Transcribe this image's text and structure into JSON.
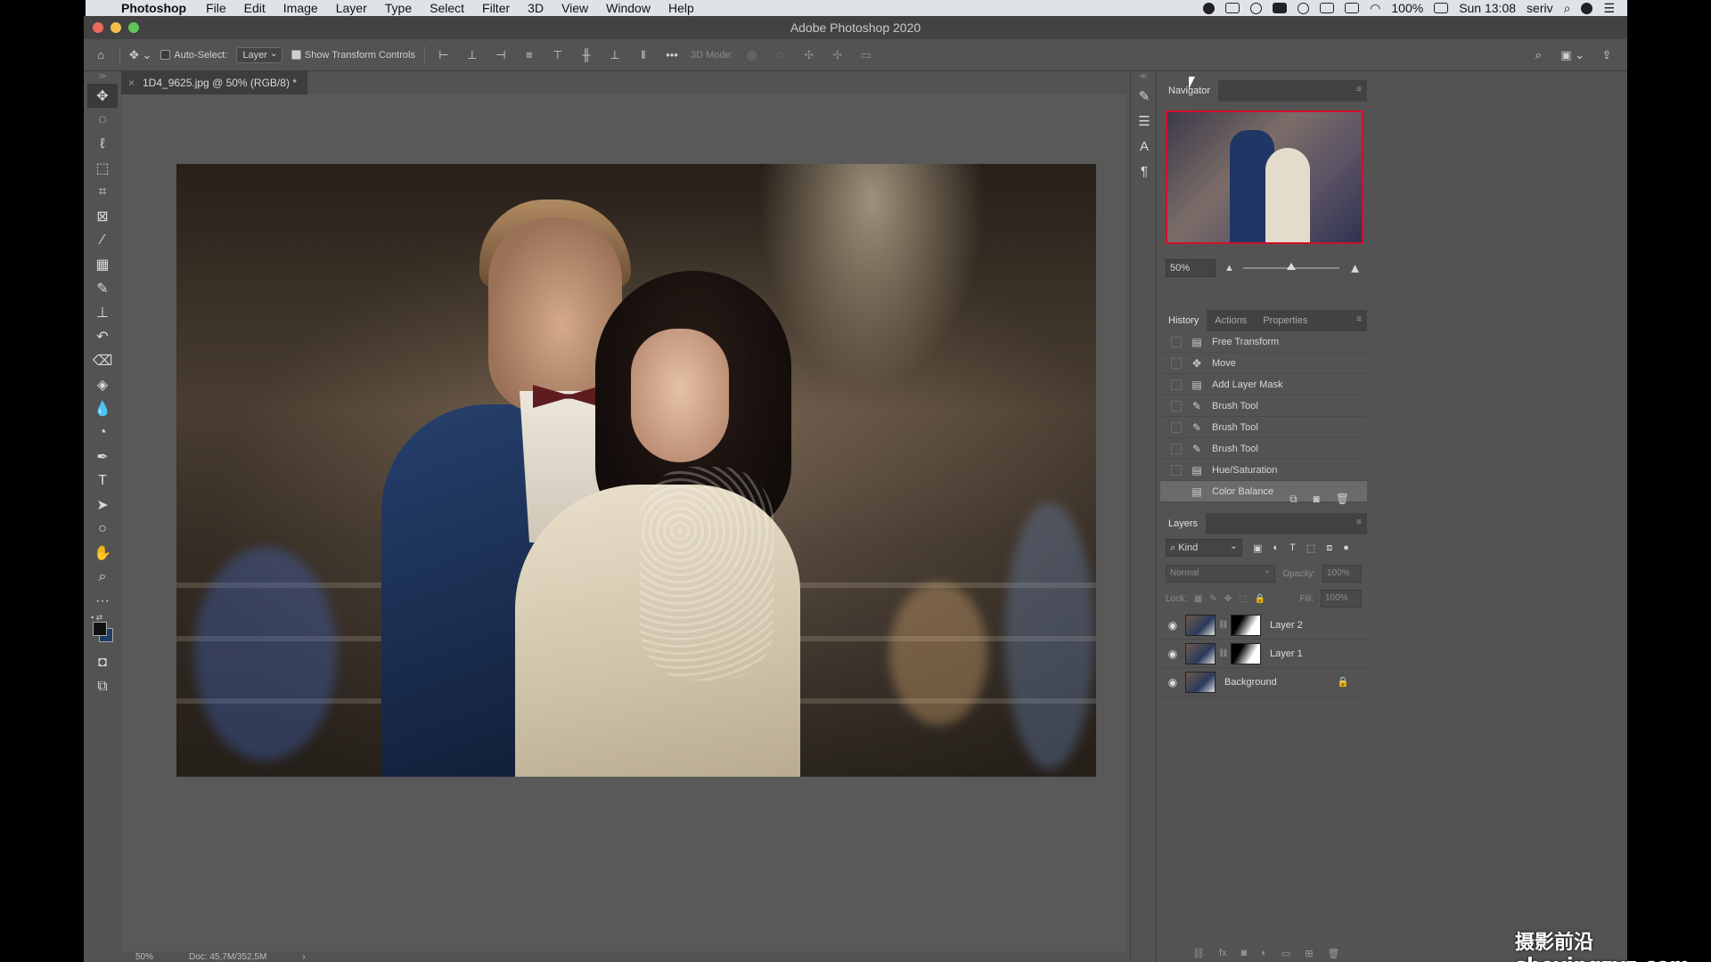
{
  "menubar": {
    "app_name": "Photoshop",
    "menus": [
      "File",
      "Edit",
      "Image",
      "Layer",
      "Type",
      "Select",
      "Filter",
      "3D",
      "View",
      "Window",
      "Help"
    ],
    "battery": "100%",
    "clock": "Sun 13:08",
    "user": "seriv"
  },
  "window": {
    "title": "Adobe Photoshop 2020"
  },
  "options_bar": {
    "auto_select_label": "Auto-Select:",
    "auto_select_checked": false,
    "auto_select_target": "Layer",
    "show_transform_label": "Show Transform Controls",
    "show_transform_checked": true,
    "mode_3d_label": "3D Mode:"
  },
  "document": {
    "tab_title": "1D4_9625.jpg @ 50% (RGB/8) *",
    "zoom": "50%",
    "doc_size": "Doc: 45,7M/352,5M"
  },
  "navigator": {
    "title": "Navigator",
    "zoom": "50%",
    "zoom_slider_fraction": 0.5
  },
  "history": {
    "tabs": [
      "History",
      "Actions",
      "Properties"
    ],
    "active_tab": "History",
    "items": [
      {
        "label": "Free Transform",
        "icon": "document-icon"
      },
      {
        "label": "Move",
        "icon": "move-icon"
      },
      {
        "label": "Add Layer Mask",
        "icon": "document-icon"
      },
      {
        "label": "Brush Tool",
        "icon": "brush-icon"
      },
      {
        "label": "Brush Tool",
        "icon": "brush-icon"
      },
      {
        "label": "Brush Tool",
        "icon": "brush-icon"
      },
      {
        "label": "Hue/Saturation",
        "icon": "document-icon"
      },
      {
        "label": "Color Balance",
        "icon": "document-icon",
        "selected": true
      }
    ]
  },
  "layers": {
    "title": "Layers",
    "filter_kind": "Kind",
    "blend_mode": "Normal",
    "opacity_label": "Opacity:",
    "opacity": "100%",
    "lock_label": "Lock:",
    "fill_label": "Fill:",
    "fill": "100%",
    "items": [
      {
        "name": "Layer 2",
        "visible": true,
        "has_mask": true,
        "locked": false
      },
      {
        "name": "Layer 1",
        "visible": true,
        "has_mask": true,
        "locked": false
      },
      {
        "name": "Background",
        "visible": true,
        "has_mask": false,
        "locked": true
      }
    ]
  },
  "watermark": "摄影前沿 sheyingzyz.com",
  "colors": {
    "foreground": "#111111",
    "background": "#1f3c68",
    "navigator_frame": "#d0102b"
  }
}
